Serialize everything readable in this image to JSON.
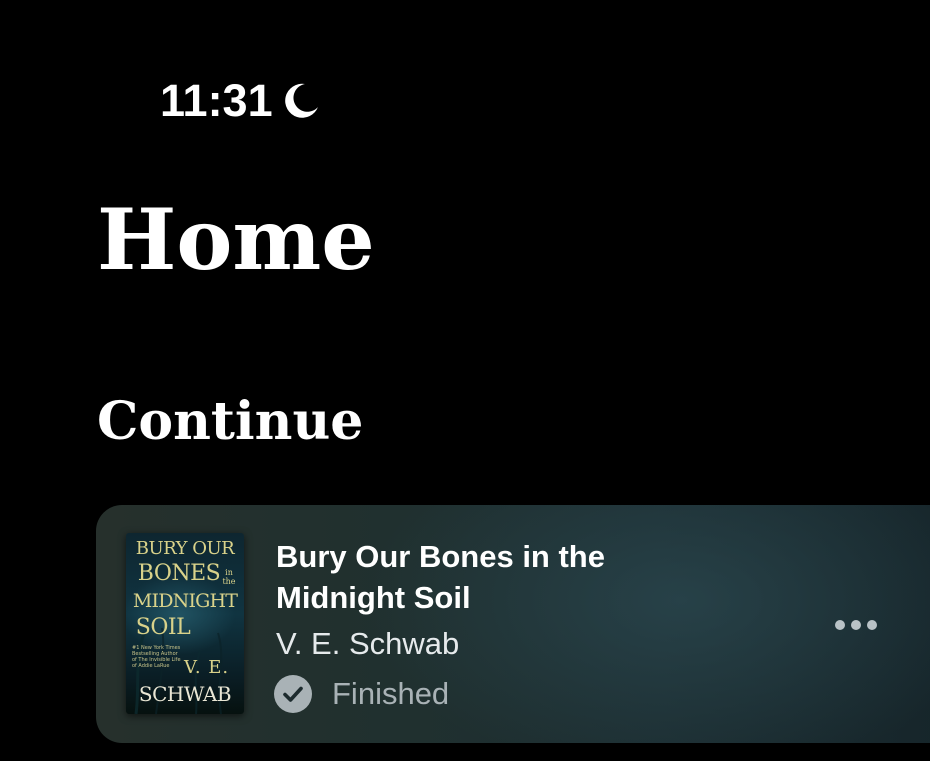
{
  "status_bar": {
    "time": "11:31",
    "focus_icon": "moon-icon"
  },
  "header": {
    "title": "Home"
  },
  "continue_section": {
    "title": "Continue",
    "items": [
      {
        "title": "Bury Our Bones in the Midnight Soil",
        "author": "V. E. Schwab",
        "status": "Finished",
        "status_icon": "checkmark-circle-icon",
        "more_icon": "more-icon",
        "cover": {
          "line1": "BURY OUR",
          "line2": "BONES",
          "small": "in the",
          "line3": "MIDNIGHT",
          "line4": "SOIL",
          "blurb": "#1 New York Times Bestselling Author of The Invisible Life of Addie LaRue",
          "author_initials": "V. E.",
          "author_surname": "SCHWAB"
        }
      }
    ]
  },
  "colors": {
    "background": "#000000",
    "text_primary": "#ffffff",
    "text_secondary": "#a9b2b6",
    "card_background": "#1f2e2f",
    "cover_text": "#d9d28a"
  }
}
